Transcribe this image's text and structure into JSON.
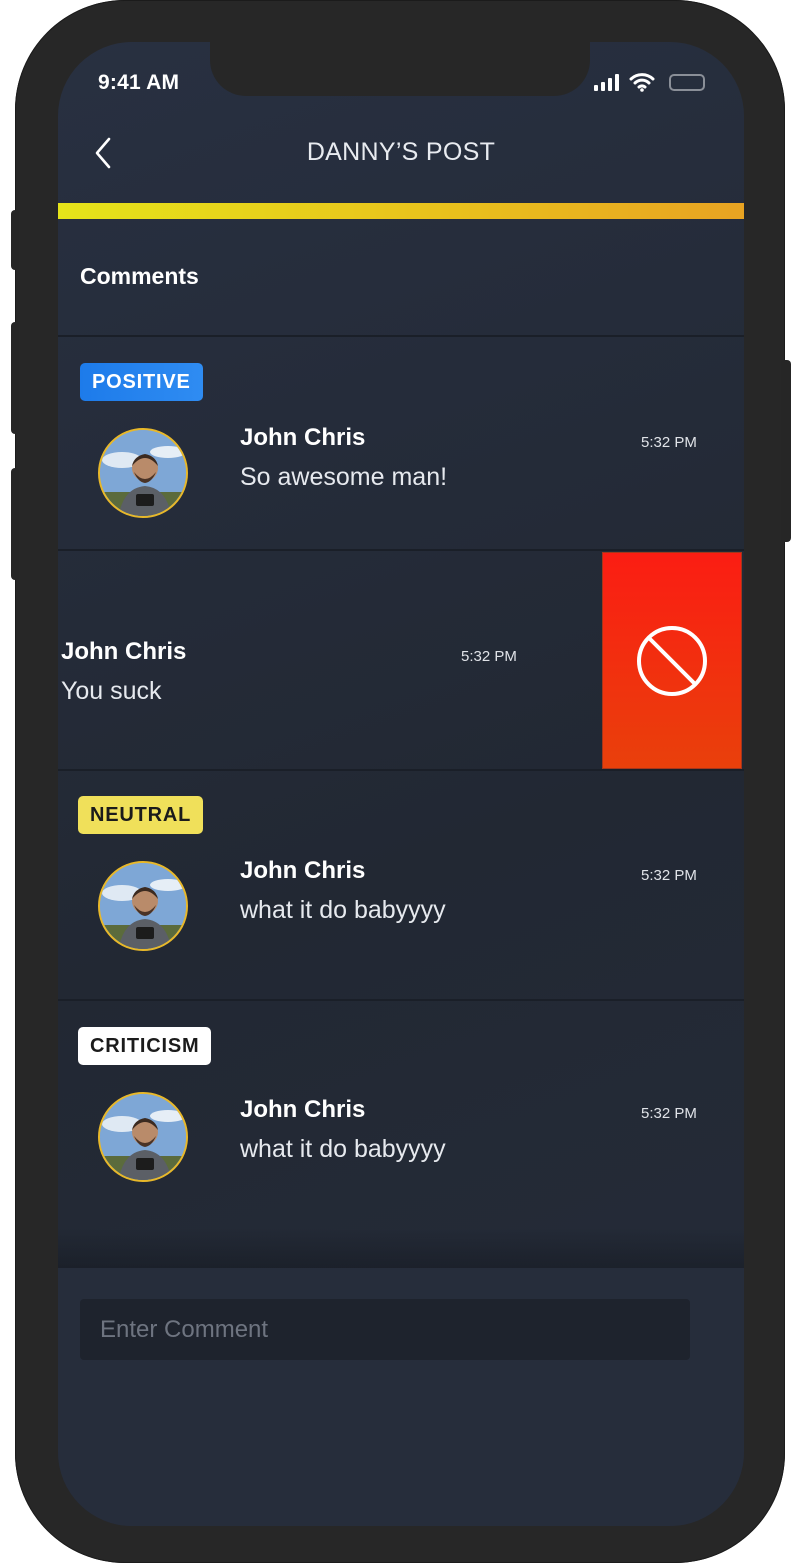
{
  "status_bar": {
    "time": "9:41 AM",
    "icons": [
      "signal-icon",
      "wifi-icon",
      "battery-icon"
    ]
  },
  "header": {
    "title": "DANNY’S POST",
    "back_icon": "chevron-left-icon"
  },
  "progress": {
    "value": 1.0,
    "colors": [
      "#e6e41a",
      "#e8a322"
    ]
  },
  "section": {
    "title": "Comments"
  },
  "comments": [
    {
      "badge": "POSITIVE",
      "badge_color": "#1d7bea",
      "author": "John Chris",
      "text": "So awesome man!",
      "time": "5:32 PM"
    },
    {
      "badge": "",
      "author": "John Chris",
      "text": "You suck",
      "time": "5:32 PM",
      "swipe_action": "block-icon",
      "swipe_color": "#fb1d13"
    },
    {
      "badge": "NEUTRAL",
      "badge_color": "#f0e05a",
      "author": "John Chris",
      "text": "what it do babyyyy",
      "time": "5:32 PM"
    },
    {
      "badge": "CRITICISM",
      "badge_color": "#ffffff",
      "author": "John Chris",
      "text": "what it do babyyyy",
      "time": "5:32 PM"
    }
  ],
  "composer": {
    "placeholder": "Enter Comment"
  }
}
